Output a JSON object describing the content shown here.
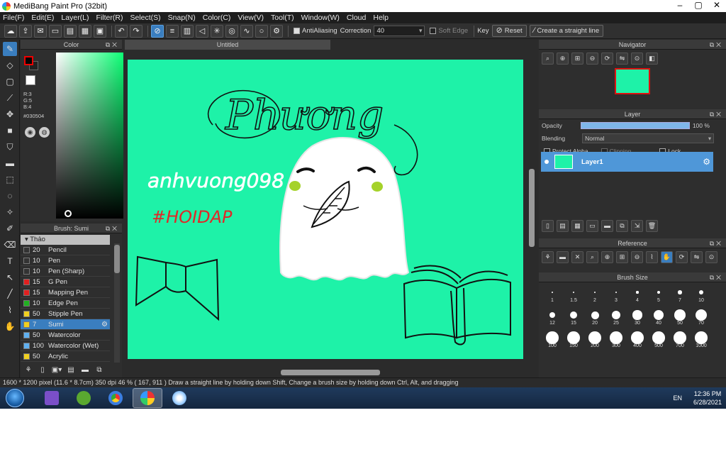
{
  "window": {
    "title": "MediBang Paint Pro (32bit)",
    "buttons": [
      "–",
      "▢",
      "✕"
    ]
  },
  "menu": [
    "File(F)",
    "Edit(E)",
    "Layer(L)",
    "Filter(R)",
    "Select(S)",
    "Snap(N)",
    "Color(C)",
    "View(V)",
    "Tool(T)",
    "Window(W)",
    "Cloud",
    "Help"
  ],
  "toolbar": {
    "antialiasing_label": "AntiAliasing",
    "correction_label": "Correction",
    "correction_value": "40",
    "soft_edge_label": "Soft Edge",
    "key_label": "Key",
    "reset_label": "Reset",
    "straight_line_label": "Create a straight line"
  },
  "color_panel": {
    "title": "Color",
    "r": "R:3",
    "g": "G:5",
    "b": "B:4",
    "hex": "#030504",
    "primary_color": "#030504",
    "hue_color": "#00ff6e"
  },
  "brush_panel": {
    "title": "Brush: Sumi",
    "group": "Thảo",
    "items": [
      {
        "size": "20",
        "name": "Pencil",
        "color": "#333333"
      },
      {
        "size": "10",
        "name": "Pen",
        "color": "#333333"
      },
      {
        "size": "10",
        "name": "Pen (Sharp)",
        "color": "#333333"
      },
      {
        "size": "15",
        "name": "G Pen",
        "color": "#e02020"
      },
      {
        "size": "15",
        "name": "Mapping Pen",
        "color": "#e02020"
      },
      {
        "size": "10",
        "name": "Edge Pen",
        "color": "#20b020"
      },
      {
        "size": "50",
        "name": "Stipple Pen",
        "color": "#f0d020"
      },
      {
        "size": "7",
        "name": "Sumi",
        "color": "#f0d020",
        "active": true
      },
      {
        "size": "50",
        "name": "Watercolor",
        "color": "#60b0f0"
      },
      {
        "size": "100",
        "name": "Watercolor (Wet)",
        "color": "#60b0f0"
      },
      {
        "size": "50",
        "name": "Acrylic",
        "color": "#f0d020"
      }
    ]
  },
  "document": {
    "tab_title": "Untitled",
    "canvas_color": "#1ef2a8"
  },
  "artwork": {
    "script_text": "Phương",
    "handwriting": "anhvuong098",
    "hashtag": "#HOIDAP"
  },
  "navigator": {
    "title": "Navigator"
  },
  "layer_panel": {
    "title": "Layer",
    "opacity_label": "Opacity",
    "opacity_value": "100 %",
    "opacity": 1.0,
    "blending_label": "Blending",
    "blending_value": "Normal",
    "protect_alpha_label": "Protect Alpha",
    "clipping_label": "Clipping",
    "lock_label": "Lock",
    "layer_name": "Layer1"
  },
  "reference": {
    "title": "Reference"
  },
  "brush_size": {
    "title": "Brush Size",
    "sizes": [
      "1",
      "1.5",
      "2",
      "3",
      "4",
      "5",
      "7",
      "10",
      "12",
      "15",
      "20",
      "25",
      "30",
      "40",
      "50",
      "70",
      "100",
      "150",
      "200",
      "300",
      "400",
      "500",
      "700",
      "1000"
    ]
  },
  "status": {
    "text": "1600 * 1200 pixel   (11.6 * 8.7cm)   350 dpi   46 %   ( 167, 911 )   Draw a straight line by holding down Shift, Change a brush size by holding down Ctrl, Alt, and dragging"
  },
  "taskbar": {
    "lang": "EN",
    "time": "12:36 PM",
    "date": "6/28/2021"
  }
}
